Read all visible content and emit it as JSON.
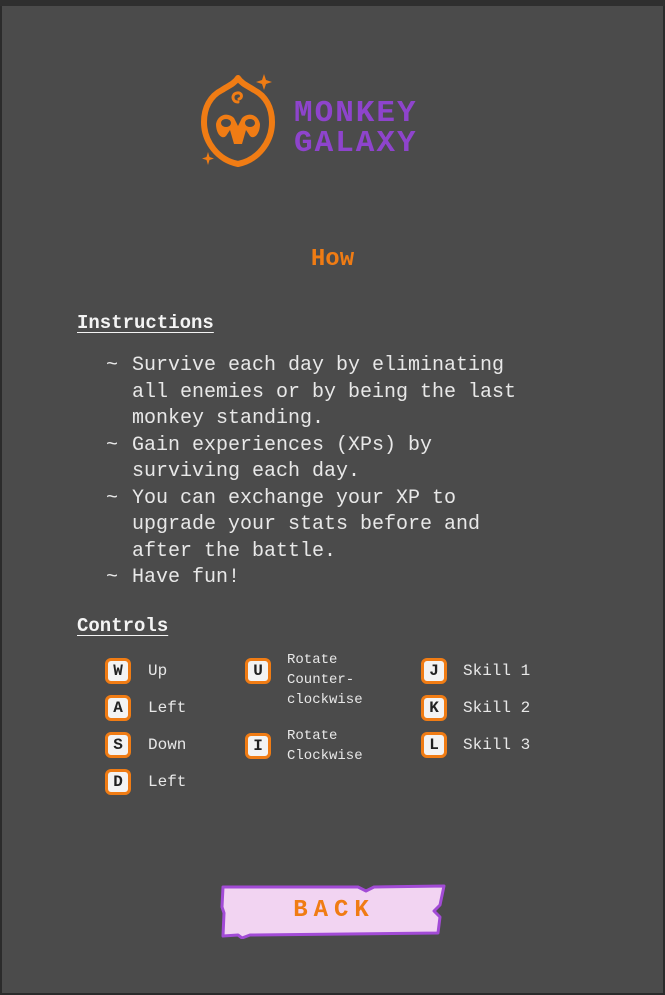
{
  "logo": {
    "line1": "MONKEY",
    "line2": "GALAXY",
    "icon": "monkey-face-icon",
    "brand_color": "#8e44cc",
    "accent_color": "#f07c14"
  },
  "page_title": "How",
  "instructions": {
    "heading": "Instructions",
    "bullet": "~",
    "items": [
      [
        "Survive each day by eliminating",
        "all enemies or by being the last",
        "monkey standing."
      ],
      [
        "Gain experiences (XPs) by",
        "surviving each day."
      ],
      [
        "You can exchange your XP to",
        "upgrade your stats before and",
        "after the battle."
      ],
      [
        "Have fun!"
      ]
    ]
  },
  "controls": {
    "heading": "Controls",
    "movement": [
      {
        "key": "W",
        "label": "Up"
      },
      {
        "key": "A",
        "label": "Left"
      },
      {
        "key": "S",
        "label": "Down"
      },
      {
        "key": "D",
        "label": "Left"
      }
    ],
    "rotation": [
      {
        "key": "U",
        "label_lines": [
          "Rotate",
          "Counter-",
          "clockwise"
        ]
      },
      {
        "key": "I",
        "label_lines": [
          "Rotate",
          "Clockwise"
        ]
      }
    ],
    "skills": [
      {
        "key": "J",
        "label": "Skill 1"
      },
      {
        "key": "K",
        "label": "Skill 2"
      },
      {
        "key": "L",
        "label": "Skill 3"
      }
    ]
  },
  "back_button": {
    "label": "BACK",
    "fill_color": "#f2d4f2",
    "border_color": "#a24bd6"
  }
}
